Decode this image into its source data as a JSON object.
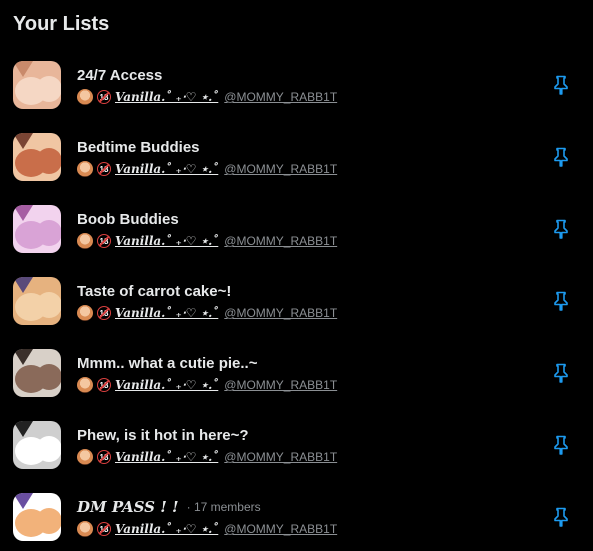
{
  "header": {
    "title": "Your Lists"
  },
  "accent_color": "#1d9bf0",
  "lists": [
    {
      "title": "24/7 Access",
      "script_title": false,
      "members": "",
      "owner_name": "Vanilla.˚ ₊‧♡ ⋆.˚",
      "owner_handle": "@MOMMY_RABB1T",
      "thumb_colors": [
        "#f5d7c4",
        "#e8b69a",
        "#c98a6b"
      ],
      "pin_icon": "pin-icon"
    },
    {
      "title": "Bedtime Buddies",
      "script_title": false,
      "members": "",
      "owner_name": "Vanilla.˚ ₊‧♡ ⋆.˚",
      "owner_handle": "@MOMMY_RABB1T",
      "thumb_colors": [
        "#c96e4a",
        "#f0c6a3",
        "#7a4534"
      ],
      "pin_icon": "pin-icon"
    },
    {
      "title": "Boob Buddies",
      "script_title": false,
      "members": "",
      "owner_name": "Vanilla.˚ ₊‧♡ ⋆.˚",
      "owner_handle": "@MOMMY_RABB1T",
      "thumb_colors": [
        "#d9a3d6",
        "#f2d3ee",
        "#a65ea3"
      ],
      "pin_icon": "pin-icon"
    },
    {
      "title": "Taste of carrot cake~!",
      "script_title": false,
      "members": "",
      "owner_name": "Vanilla.˚ ₊‧♡ ⋆.˚",
      "owner_handle": "@MOMMY_RABB1T",
      "thumb_colors": [
        "#f3d1a8",
        "#e6b27f",
        "#5a4a7a"
      ],
      "pin_icon": "pin-icon"
    },
    {
      "title": "Mmm.. what a cutie pie..~",
      "script_title": false,
      "members": "",
      "owner_name": "Vanilla.˚ ₊‧♡ ⋆.˚",
      "owner_handle": "@MOMMY_RABB1T",
      "thumb_colors": [
        "#8a6a5a",
        "#d8d0c8",
        "#3a2f2a"
      ],
      "pin_icon": "pin-icon"
    },
    {
      "title": "Phew, is it hot in here~?",
      "script_title": false,
      "members": "",
      "owner_name": "Vanilla.˚ ₊‧♡ ⋆.˚",
      "owner_handle": "@MOMMY_RABB1T",
      "thumb_colors": [
        "#ffffff",
        "#cfcfcf",
        "#222222"
      ],
      "pin_icon": "pin-icon"
    },
    {
      "title": "DM PASS ! !",
      "script_title": true,
      "members": "· 17 members",
      "owner_name": "Vanilla.˚ ₊‧♡ ⋆.˚",
      "owner_handle": "@MOMMY_RABB1T",
      "thumb_colors": [
        "#f2b27a",
        "#ffffff",
        "#6a4fa0"
      ],
      "pin_icon": "pin-icon"
    }
  ]
}
